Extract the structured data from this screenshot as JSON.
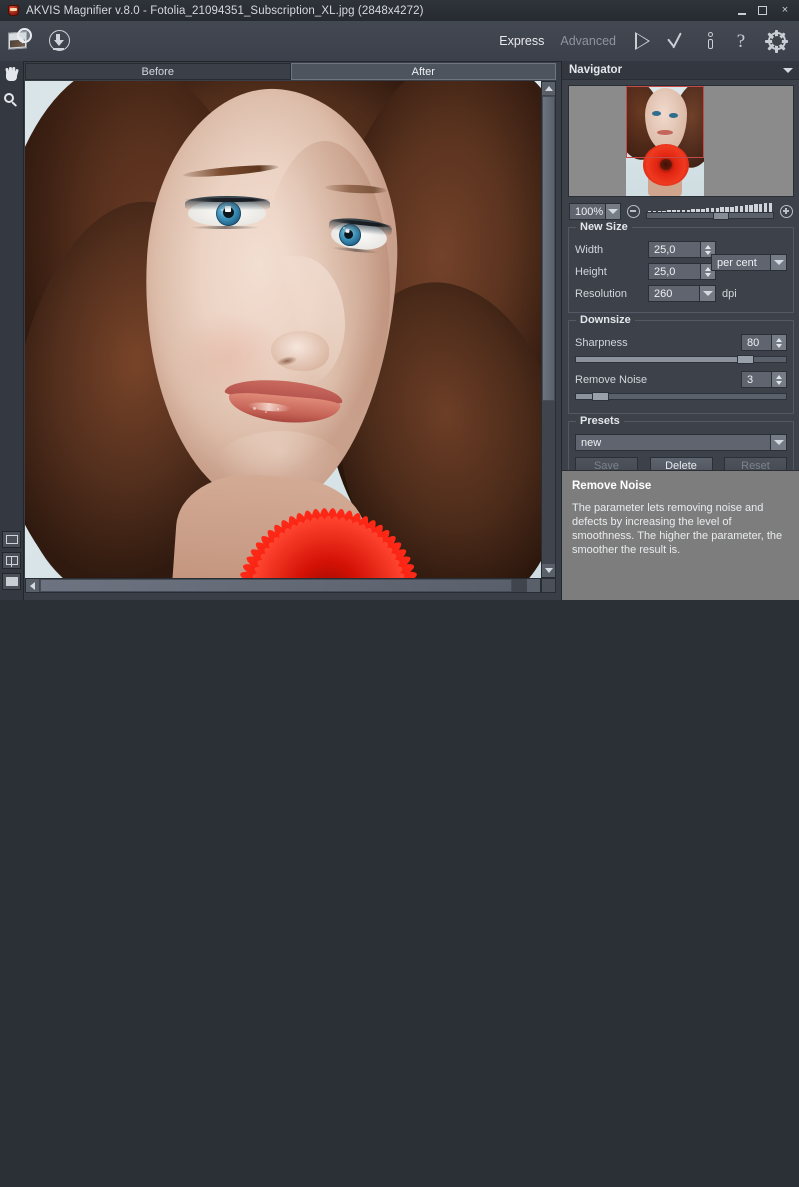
{
  "window": {
    "title": "AKVIS Magnifier v.8.0 - Fotolia_21094351_Subscription_XL.jpg (2848x4272)",
    "logo_icon": "akvis-logo-icon",
    "minimize_icon": "minimize-icon",
    "maximize_icon": "maximize-icon",
    "close_icon": "close-icon",
    "close_glyph": "×"
  },
  "toolbar": {
    "open_image_icon": "open-image-icon",
    "save_image_icon": "save-image-icon",
    "express_label": "Express",
    "advanced_label": "Advanced",
    "run_icon": "run-icon",
    "apply_icon": "apply-check-icon",
    "info_icon": "info-icon",
    "help_icon": "help-question-icon",
    "help_glyph": "?",
    "settings_icon": "settings-gear-icon"
  },
  "tools": {
    "hand_icon": "hand-tool-icon",
    "zoom_icon": "zoom-tool-icon",
    "view_single_icon": "view-single-window-icon",
    "view_split_icon": "view-split-window-icon",
    "view_solid_icon": "view-solid-window-icon"
  },
  "tabs": [
    {
      "label": "Before",
      "active": false
    },
    {
      "label": "After",
      "active": true
    }
  ],
  "navigator": {
    "title": "Navigator",
    "collapse_icon": "chevron-down-icon",
    "zoom_value": "100%",
    "zoom_dropdown_icon": "chevron-down-icon",
    "zoom_out_icon": "zoom-out-circle-icon",
    "zoom_in_icon": "zoom-in-circle-icon"
  },
  "new_size": {
    "group_label": "New Size",
    "width_label": "Width",
    "width_value": "25,0",
    "height_label": "Height",
    "height_value": "25,0",
    "resolution_label": "Resolution",
    "resolution_value": "260",
    "units_value": "per cent",
    "dpi_label": "dpi"
  },
  "downsize": {
    "group_label": "Downsize",
    "sharpness_label": "Sharpness",
    "sharpness_value": "80",
    "sharpness_percent": 80,
    "remove_noise_label": "Remove Noise",
    "remove_noise_value": "3",
    "remove_noise_percent": 12
  },
  "presets": {
    "group_label": "Presets",
    "selected": "new",
    "dropdown_icon": "chevron-down-icon",
    "save_label": "Save",
    "save_enabled": false,
    "delete_label": "Delete",
    "delete_enabled": true,
    "reset_label": "Reset",
    "reset_enabled": false
  },
  "help": {
    "title": "Remove Noise",
    "text": "The parameter lets removing noise and defects by increasing the level of smoothness. The higher the parameter, the smoother the result is."
  },
  "colors": {
    "panel_bg": "#3c414a",
    "titlebar_bg": "#2f333a",
    "help_bg": "#7d7d7d",
    "nav_viewport": "#c54a4a",
    "text": "#e4e8ec"
  }
}
